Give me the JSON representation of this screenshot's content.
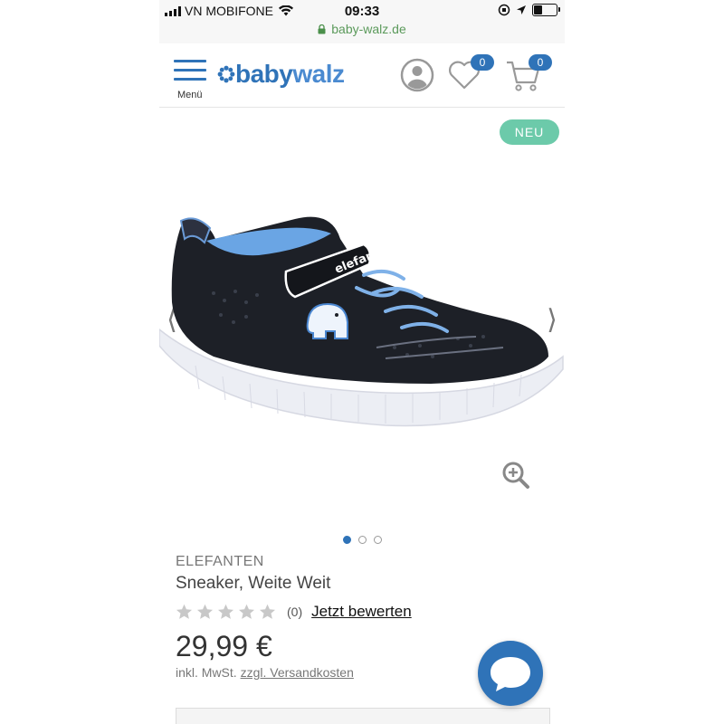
{
  "status_bar": {
    "carrier": "VN MOBIFONE",
    "time": "09:33",
    "battery_level": 0.35,
    "url": "baby-walz.de",
    "icons": [
      "signal-icon",
      "wifi-icon",
      "orientation-lock-icon",
      "location-icon",
      "battery-icon",
      "lock-icon"
    ]
  },
  "header": {
    "menu_label": "Menü",
    "logo_baby": "baby",
    "logo_walz": "walz",
    "wishlist_count": "0",
    "cart_count": "0",
    "icons": [
      "menu-icon",
      "flower-logo-icon",
      "account-icon",
      "heart-icon",
      "cart-icon"
    ]
  },
  "gallery": {
    "badge": "NEU",
    "prev": "⟨",
    "next": "⟩",
    "image_count": 3,
    "active_index": 0,
    "icons": [
      "zoom-icon"
    ]
  },
  "product": {
    "brand": "ELEFANTEN",
    "name": "Sneaker, Weite Weit",
    "rating_stars": 0,
    "rating_max": 5,
    "rating_count": "(0)",
    "rate_link": "Jetzt bewerten",
    "price": "29,99 €",
    "tax_prefix": "inkl. MwSt. ",
    "shipping_link": "zzgl. Versandkosten"
  },
  "colors": {
    "brand_blue": "#2f73b8",
    "neu_green": "#6ccaaa",
    "secure_green": "#4a8f4a",
    "star_gray": "#c8c8c8"
  }
}
